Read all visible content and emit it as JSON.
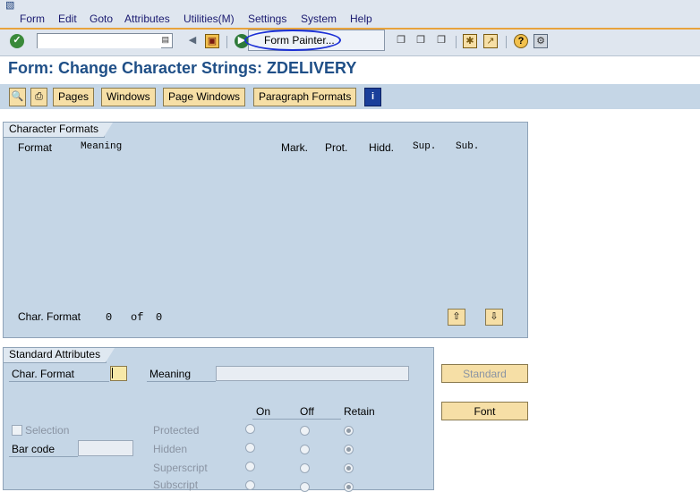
{
  "menu": {
    "items": [
      "Form",
      "Edit",
      "Goto",
      "Attributes",
      "Utilities(M)",
      "Settings",
      "System",
      "Help"
    ]
  },
  "toolbar": {
    "command_value": "",
    "icons": [
      "enter-icon",
      "back-arrow-icon",
      "save-icon",
      "forward-icon",
      "copy-page-icon",
      "find-icon",
      "find-next-icon",
      "layout-icon",
      "create-session-icon",
      "help-icon",
      "settings-icon"
    ]
  },
  "dropdown": {
    "item": "Form Painter..."
  },
  "title": "Form: Change Character Strings: ZDELIVERY",
  "app_toolbar": {
    "buttons": [
      "Pages",
      "Windows",
      "Page Windows",
      "Paragraph Formats"
    ]
  },
  "char_formats": {
    "title": "Character Formats",
    "columns": {
      "format": "Format",
      "meaning": "Meaning",
      "mark": "Mark.",
      "prot": "Prot.",
      "hidd": "Hidd.",
      "sup": "Sup.",
      "sub": "Sub."
    },
    "footer": {
      "label": "Char. Format",
      "current": "0",
      "of": "of",
      "total": "0"
    }
  },
  "std_attrs": {
    "title": "Standard Attributes",
    "char_format_label": "Char. Format",
    "char_format_value": "",
    "meaning_label": "Meaning",
    "meaning_value": "",
    "on_label": "On",
    "off_label": "Off",
    "retain_label": "Retain",
    "selection_label": "Selection",
    "barcode_label": "Bar code",
    "barcode_value": "",
    "rows": [
      "Protected",
      "Hidden",
      "Superscript",
      "Subscript"
    ]
  },
  "side_buttons": {
    "standard": "Standard",
    "font": "Font"
  },
  "colors": {
    "accent_orange": "#e8a33c",
    "title_blue": "#1f4f87",
    "panel_blue": "#c5d6e6",
    "button_yellow": "#f6dfa6",
    "highlight_ellipse": "#1b2fd6"
  }
}
